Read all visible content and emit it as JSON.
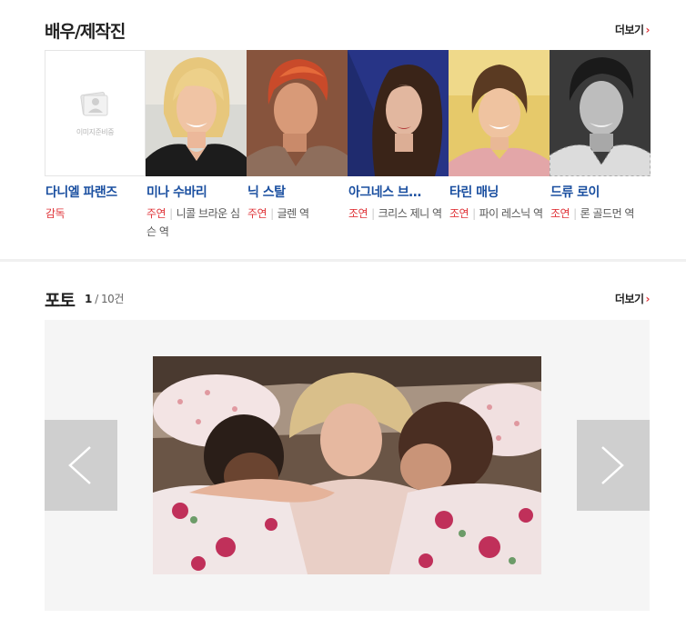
{
  "cast_section": {
    "title": "배우/제작진",
    "more_label": "더보기",
    "placeholder_text": "이미지준비중",
    "members": [
      {
        "name": "다니엘 파랜즈",
        "type": "감독",
        "role": ""
      },
      {
        "name": "미나 수바리",
        "type": "주연",
        "role": "니콜 브라운 심슨 역"
      },
      {
        "name": "닉 스탈",
        "type": "주연",
        "role": "글렌 역"
      },
      {
        "name": "아그네스 브…",
        "type": "조연",
        "role": "크리스 제니 역"
      },
      {
        "name": "타린 매닝",
        "type": "조연",
        "role": "파이 레스닉 역"
      },
      {
        "name": "드류 로이",
        "type": "조연",
        "role": "론 골드먼 역"
      }
    ]
  },
  "photo_section": {
    "title": "포토",
    "counter_current": "1",
    "counter_total": "/ 10건",
    "more_label": "더보기"
  },
  "colors": {
    "accent_red": "#e0363b",
    "name_blue": "#1a4fa0",
    "stage_bg": "#f5f5f5",
    "nav_bg": "#cfcfcf"
  },
  "icons": {
    "more": "chevron-right-icon",
    "prev": "chevron-left-icon",
    "next": "chevron-right-icon",
    "placeholder": "person-placeholder-icon"
  }
}
